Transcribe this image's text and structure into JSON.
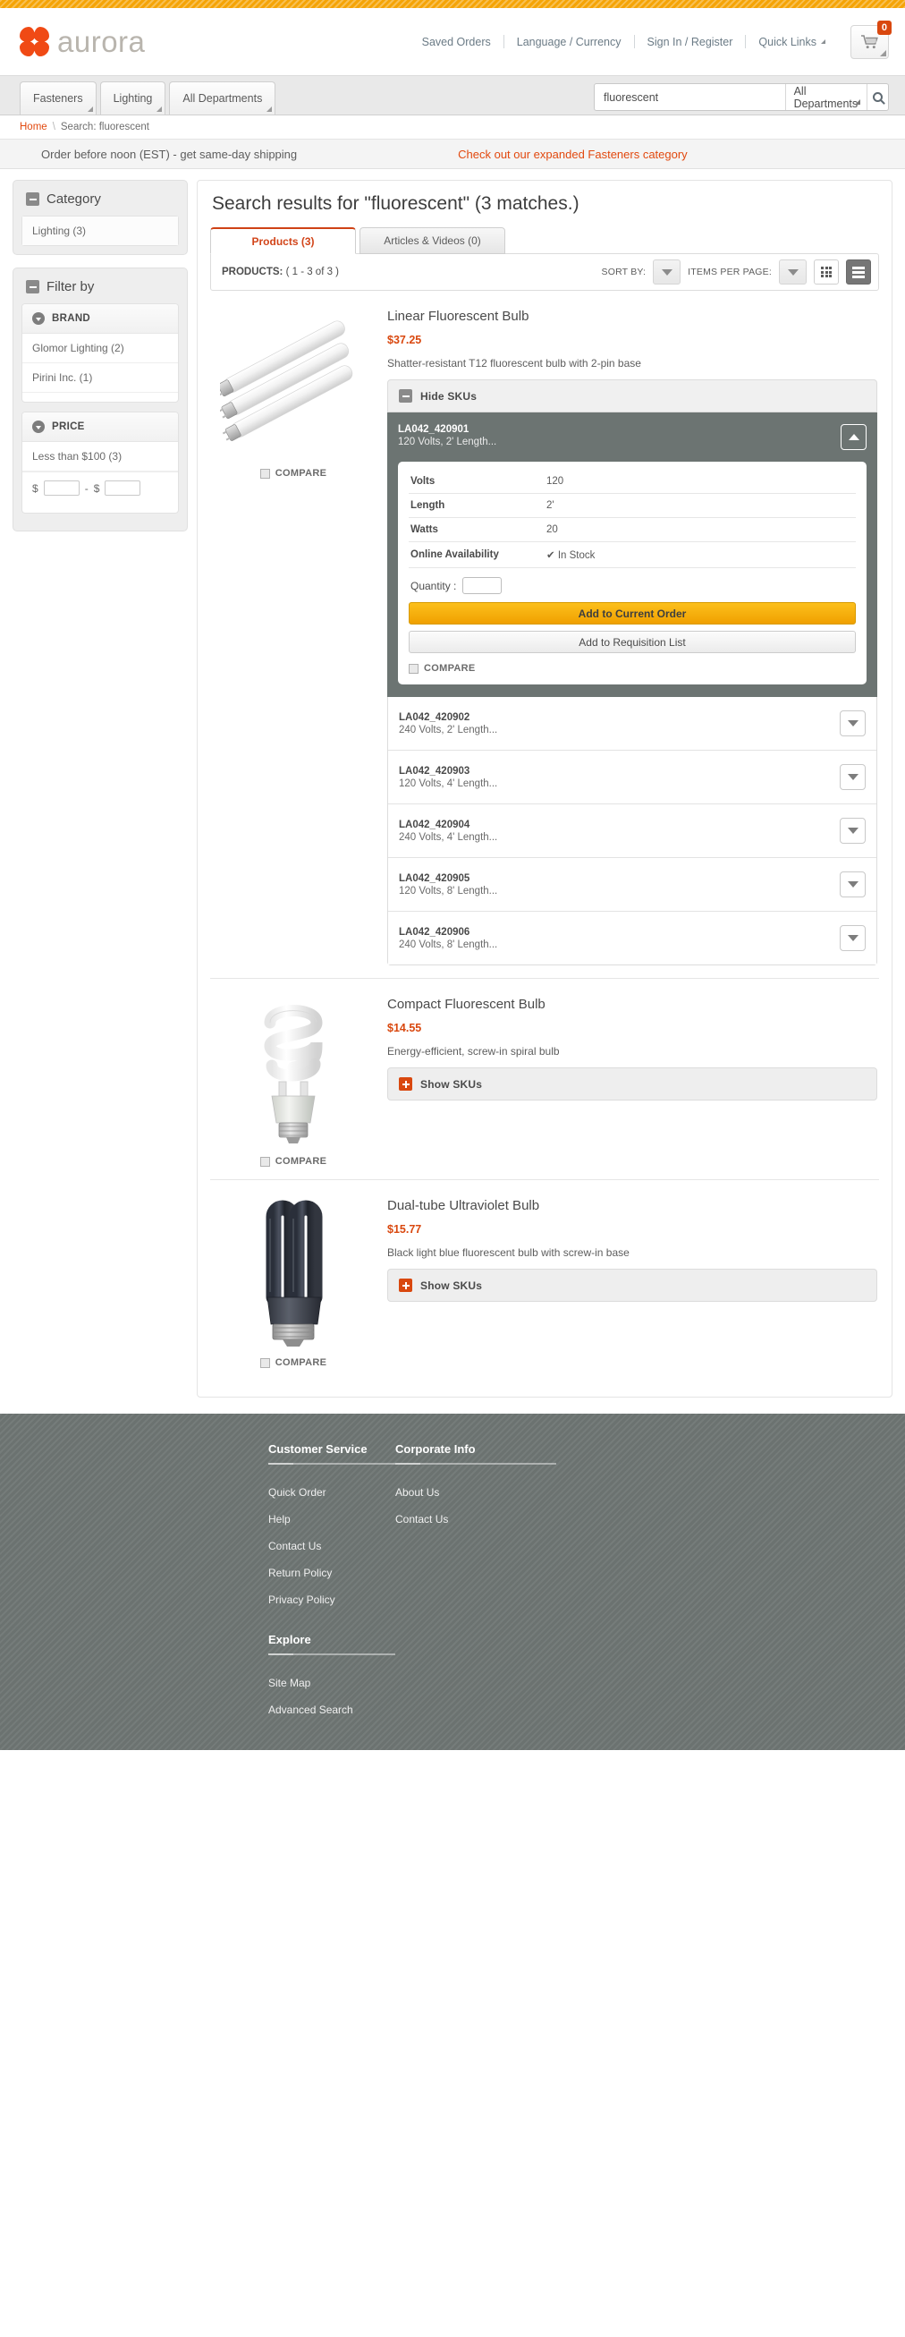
{
  "brand": {
    "name": "aurora",
    "accent": "#f04a15"
  },
  "header": {
    "links": [
      "Saved Orders",
      "Language / Currency",
      "Sign In / Register",
      "Quick Links"
    ],
    "cart_count": "0"
  },
  "nav": {
    "tabs": [
      "Fasteners",
      "Lighting",
      "All Departments"
    ],
    "search": {
      "value": "fluorescent",
      "placeholder": "",
      "department": "All Departments"
    }
  },
  "breadcrumb": {
    "home": "Home",
    "separator": "\\",
    "current": "Search: fluorescent"
  },
  "promo": {
    "left": "Order before noon (EST) - get same-day shipping",
    "right": "Check out our expanded Fasteners category"
  },
  "sidebar": {
    "category": {
      "title": "Category",
      "items": [
        "Lighting (3)"
      ]
    },
    "filter": {
      "title": "Filter by",
      "facets": [
        {
          "label": "BRAND",
          "options": [
            "Glomor Lighting (2)",
            "Pirini Inc. (1)"
          ]
        },
        {
          "label": "PRICE",
          "options": [
            "Less than $100 (3)"
          ],
          "range": {
            "currency": "$",
            "dash": "-",
            "min": "",
            "max": ""
          }
        }
      ]
    }
  },
  "main": {
    "title": "Search results for \"fluorescent\" (3 matches.)",
    "tabs": [
      {
        "label": "Products (3)",
        "active": true
      },
      {
        "label": "Articles & Videos (0)",
        "active": false
      }
    ],
    "toolbar": {
      "products_label": "PRODUCTS:",
      "products_range": "(  1 - 3 of 3  )",
      "sort_by_label": "SORT BY:",
      "items_per_page_label": "ITEMS PER PAGE:",
      "grid_view": "grid-view-icon",
      "list_view": "list-view-icon"
    },
    "compare_label": "COMPARE",
    "products": [
      {
        "name": "Linear Fluorescent Bulb",
        "price": "$37.25",
        "description": "Shatter-resistant T12 fluorescent bulb with 2-pin base",
        "image": "linear-fluorescent-tubes-photo",
        "sku_toggle": "Hide  SKUs",
        "sku_toggle_state": "open",
        "expanded_sku": {
          "id": "LA042_420901",
          "summary": "120 Volts, 2' Length...",
          "specs": [
            {
              "key": "Volts",
              "value": "120"
            },
            {
              "key": "Length",
              "value": "2'"
            },
            {
              "key": "Watts",
              "value": "20"
            },
            {
              "key": "Online Availability",
              "value": "In Stock",
              "status": true
            }
          ],
          "quantity_label": "Quantity :",
          "quantity_value": "",
          "primary_button": "Add to Current Order",
          "secondary_button": "Add to Requisition List",
          "compare_label": "COMPARE"
        },
        "skus": [
          {
            "id": "LA042_420902",
            "summary": "240 Volts, 2' Length..."
          },
          {
            "id": "LA042_420903",
            "summary": "120 Volts, 4' Length..."
          },
          {
            "id": "LA042_420904",
            "summary": "240 Volts, 4' Length..."
          },
          {
            "id": "LA042_420905",
            "summary": "120 Volts, 8' Length..."
          },
          {
            "id": "LA042_420906",
            "summary": "240 Volts, 8' Length..."
          }
        ]
      },
      {
        "name": "Compact Fluorescent Bulb",
        "price": "$14.55",
        "description": "Energy-efficient, screw-in spiral bulb",
        "image": "compact-spiral-bulb-photo",
        "sku_toggle": "Show  SKUs",
        "sku_toggle_state": "closed"
      },
      {
        "name": "Dual-tube Ultraviolet Bulb",
        "price": "$15.77",
        "description": "Black light blue fluorescent bulb with screw-in base",
        "image": "dual-tube-uv-bulb-photo",
        "sku_toggle": "Show  SKUs",
        "sku_toggle_state": "closed"
      }
    ]
  },
  "footer": {
    "columns": [
      {
        "heading": "Customer Service",
        "links": [
          "Quick Order",
          "Help",
          "Contact Us",
          "Return Policy",
          "Privacy Policy"
        ]
      },
      {
        "heading": "Corporate Info",
        "links": [
          "About Us",
          "Contact Us"
        ]
      }
    ],
    "explore": {
      "heading": "Explore",
      "links": [
        "Site Map",
        "Advanced Search"
      ]
    }
  }
}
